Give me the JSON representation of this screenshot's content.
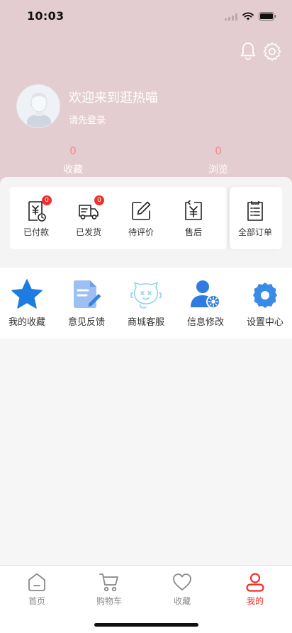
{
  "status_bar": {
    "time": "10:03"
  },
  "profile": {
    "welcome": "欢迎来到逛热喵",
    "login_hint": "请先登录",
    "stats": [
      {
        "value": "0",
        "label": "收藏"
      },
      {
        "value": "0",
        "label": "浏览"
      }
    ]
  },
  "orders": {
    "items": [
      {
        "label": "已付款",
        "badge": "0"
      },
      {
        "label": "已发货",
        "badge": "0"
      },
      {
        "label": "待评价"
      },
      {
        "label": "售后"
      }
    ],
    "all_label": "全部订单"
  },
  "services": [
    {
      "label": "我的收藏",
      "icon": "star-icon"
    },
    {
      "label": "意见反馈",
      "icon": "feedback-icon"
    },
    {
      "label": "商城客服",
      "icon": "customer-service-icon"
    },
    {
      "label": "信息修改",
      "icon": "user-settings-icon"
    },
    {
      "label": "设置中心",
      "icon": "gear-icon"
    }
  ],
  "tabbar": {
    "items": [
      {
        "label": "首页"
      },
      {
        "label": "购物车"
      },
      {
        "label": "收藏"
      },
      {
        "label": "我的"
      }
    ],
    "active_index": 3
  },
  "colors": {
    "header_bg": "#e4cdd0",
    "accent_red": "#f0302d",
    "stat_number": "#f5878c",
    "service_blue": "#1d7ce0"
  }
}
